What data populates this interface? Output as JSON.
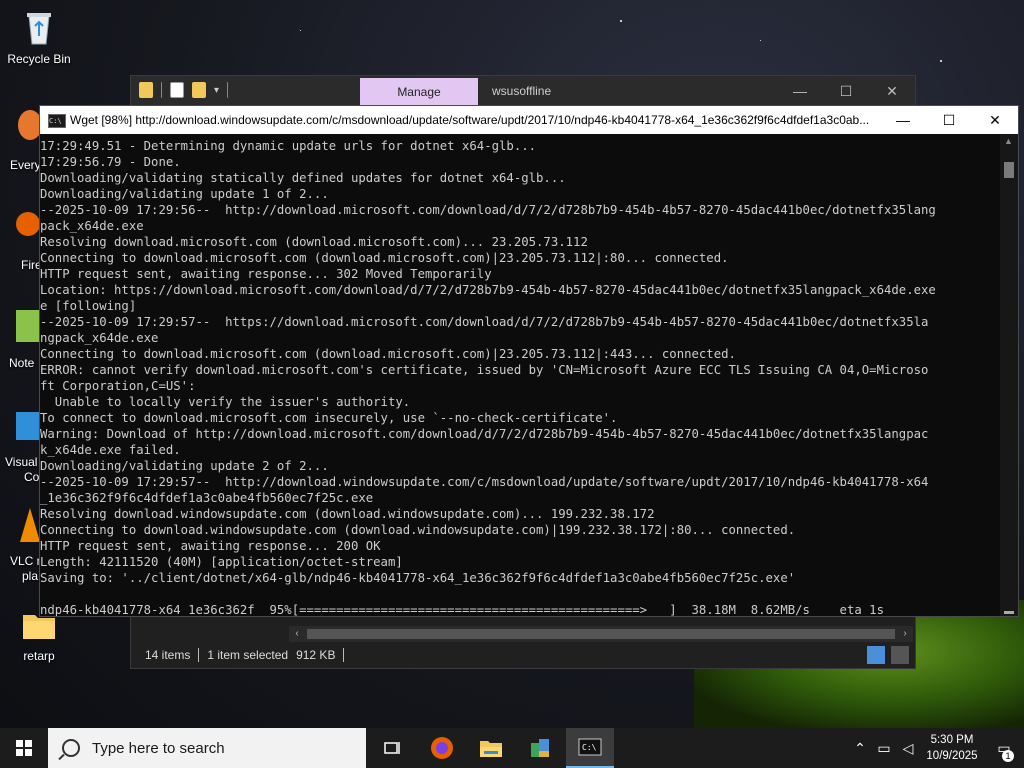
{
  "desktop": {
    "icons": [
      {
        "label": "Recycle Bin",
        "icon": "recycle-bin-icon"
      },
      {
        "label": "retarp",
        "icon": "folder-icon"
      }
    ],
    "partial_labels": [
      "Every",
      "Fire",
      "Note",
      "Visual",
      "Co",
      "VLC m",
      "pla"
    ]
  },
  "explorer": {
    "manage_tab": "Manage",
    "title": "wsusoffline",
    "status": {
      "items": "14 items",
      "selected": "1 item selected",
      "size": "912 KB"
    }
  },
  "console": {
    "title": "Wget [98%] http://download.windowsupdate.com/c/msdownload/update/software/updt/2017/10/ndp46-kb4041778-x64_1e36c362f9f6c4dfdef1a3c0ab...",
    "lines": [
      "17:29:49.51 - Determining dynamic update urls for dotnet x64-glb...",
      "17:29:56.79 - Done.",
      "Downloading/validating statically defined updates for dotnet x64-glb...",
      "Downloading/validating update 1 of 2...",
      "--2025-10-09 17:29:56--  http://download.microsoft.com/download/d/7/2/d728b7b9-454b-4b57-8270-45dac441b0ec/dotnetfx35lang",
      "pack_x64de.exe",
      "Resolving download.microsoft.com (download.microsoft.com)... 23.205.73.112",
      "Connecting to download.microsoft.com (download.microsoft.com)|23.205.73.112|:80... connected.",
      "HTTP request sent, awaiting response... 302 Moved Temporarily",
      "Location: https://download.microsoft.com/download/d/7/2/d728b7b9-454b-4b57-8270-45dac441b0ec/dotnetfx35langpack_x64de.exe",
      "e [following]",
      "--2025-10-09 17:29:57--  https://download.microsoft.com/download/d/7/2/d728b7b9-454b-4b57-8270-45dac441b0ec/dotnetfx35la",
      "ngpack_x64de.exe",
      "Connecting to download.microsoft.com (download.microsoft.com)|23.205.73.112|:443... connected.",
      "ERROR: cannot verify download.microsoft.com's certificate, issued by 'CN=Microsoft Azure ECC TLS Issuing CA 04,O=Microso",
      "ft Corporation,C=US':",
      "  Unable to locally verify the issuer's authority.",
      "To connect to download.microsoft.com insecurely, use `--no-check-certificate'.",
      "Warning: Download of http://download.microsoft.com/download/d/7/2/d728b7b9-454b-4b57-8270-45dac441b0ec/dotnetfx35langpac",
      "k_x64de.exe failed.",
      "Downloading/validating update 2 of 2...",
      "--2025-10-09 17:29:57--  http://download.windowsupdate.com/c/msdownload/update/software/updt/2017/10/ndp46-kb4041778-x64",
      "_1e36c362f9f6c4dfdef1a3c0abe4fb560ec7f25c.exe",
      "Resolving download.windowsupdate.com (download.windowsupdate.com)... 199.232.38.172",
      "Connecting to download.windowsupdate.com (download.windowsupdate.com)|199.232.38.172|:80... connected.",
      "HTTP request sent, awaiting response... 200 OK",
      "Length: 42111520 (40M) [application/octet-stream]",
      "Saving to: '../client/dotnet/x64-glb/ndp46-kb4041778-x64_1e36c362f9f6c4dfdef1a3c0abe4fb560ec7f25c.exe'",
      "",
      "ndp46-kb4041778-x64_1e36c362f  95%[==============================================>   ]  38.18M  8.62MB/s    eta 1s"
    ]
  },
  "taskbar": {
    "search_placeholder": "Type here to search",
    "apps": [
      "task-view-icon",
      "firefox-icon",
      "file-explorer-icon",
      "app-icon",
      "terminal-icon"
    ],
    "time": "5:30 PM",
    "date": "10/9/2025",
    "notification_count": "1"
  }
}
